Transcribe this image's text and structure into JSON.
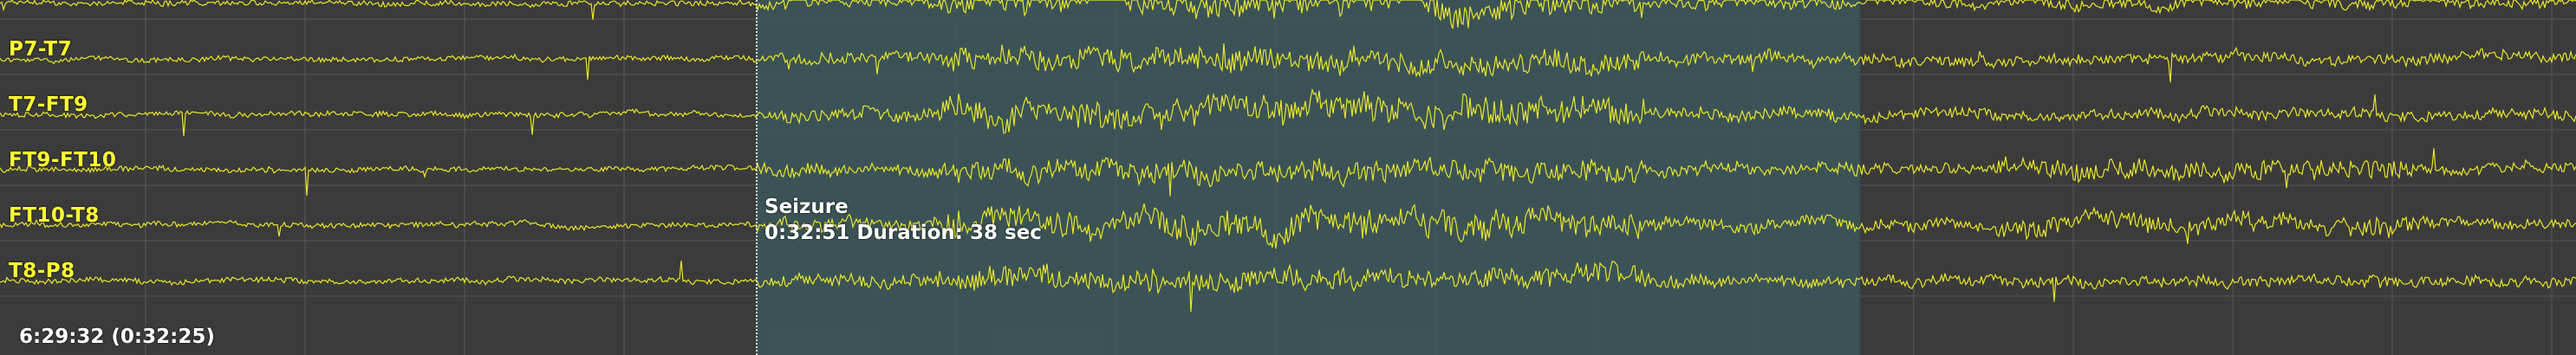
{
  "viewer": {
    "trace_color": "#e6e62a",
    "background_color": "#3b3b3b",
    "seizure_color": "#3c585c",
    "label_color": "#ffff33",
    "grid_color": "#5a5a5a"
  },
  "channels": [
    {
      "label": "P7-T7"
    },
    {
      "label": "T7-FT9"
    },
    {
      "label": "FT9-FT10"
    },
    {
      "label": "FT10-T8"
    },
    {
      "label": "T8-P8"
    }
  ],
  "annotation": {
    "title": "Seizure",
    "detail": "0:32:51 Duration: 38 sec"
  },
  "timebar": {
    "text": "6:29:32 (0:32:25)"
  }
}
